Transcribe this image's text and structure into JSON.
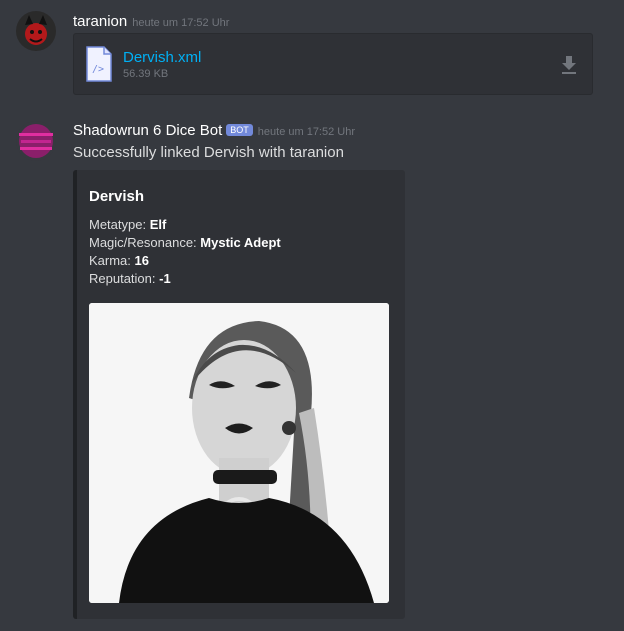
{
  "message1": {
    "username": "taranion",
    "timestamp": "heute um 17:52 Uhr",
    "attachment": {
      "filename": "Dervish.xml",
      "filesize": "56.39 KB",
      "icon": "code-file-icon",
      "download_icon": "download-icon"
    }
  },
  "message2": {
    "username": "Shadowrun 6 Dice Bot",
    "bot_tag": "BOT",
    "timestamp": "heute um 17:52 Uhr",
    "content": "Successfully linked Dervish with taranion",
    "embed": {
      "title": "Dervish",
      "fields": [
        {
          "label": "Metatype:",
          "value": "Elf"
        },
        {
          "label": "Magic/Resonance:",
          "value": "Mystic Adept"
        },
        {
          "label": "Karma:",
          "value": "16"
        },
        {
          "label": "Reputation:",
          "value": "-1"
        }
      ]
    }
  },
  "colors": {
    "background": "#36393f",
    "embed_bg": "#2f3136",
    "link": "#00b0f4",
    "bot_tag": "#7289da"
  }
}
